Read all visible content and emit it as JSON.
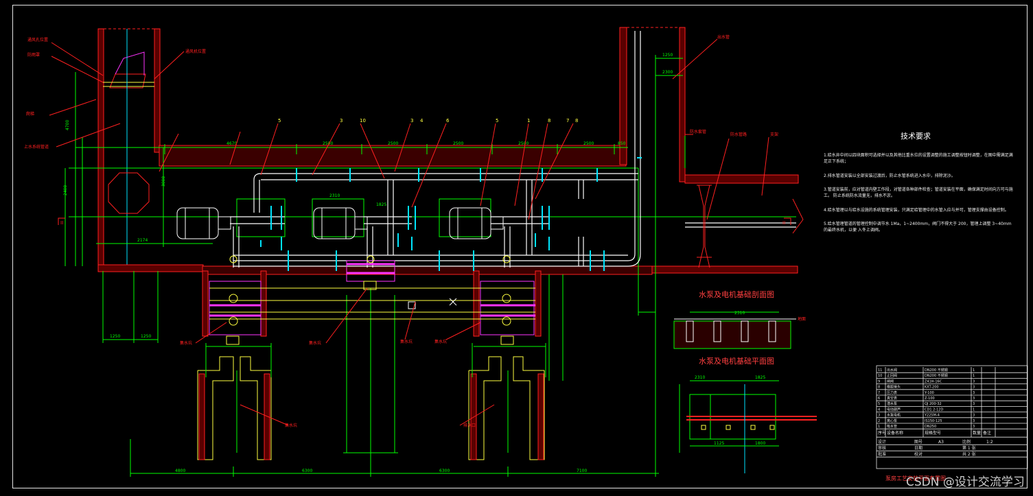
{
  "sheet": {
    "technical_requirements_title": "技术要求",
    "notes": [
      "1.给水井中间以四块面积可选择并以及其他比重水位的设置调整的施工调整按钮时调整，在图中需满足满足正下系统；",
      "2.排水管道安装以全部安装过渡后，防止水管系统进入水中，排除泥沙。",
      "3.管道安装前，应对管道内壁工作段，对管道各种部件检查；管道安装在平面，确保满足时间向方可与施工。 防止系统防水流量无，排水不淤。",
      "4.给水管理以与给水设施的系统管理安装，只满足给管理中的水管入应与并可，管理支撑由设备控制。",
      "5.给水管理管道的管理控制中调节水 1Ma，1~2400mm，阀门不得大于 200，管理上调整 3~40mm 的最终水机，以便 入冬上调阀。"
    ],
    "section_view_title": "水泵及电机基础剖面图",
    "plan_view_title": "水泵及电机基础平面图",
    "watermark": "CSDN @设计交流学习",
    "drawing_caption": "泵房工艺安装平面布置图"
  },
  "colors": {
    "background": "#000000",
    "wall": "#ff2020",
    "pipe": "#ffffff",
    "dimension": "#00ff00",
    "valve": "#00e5ff",
    "leader": "#ff2020",
    "accent": "#ff33ff",
    "yellow": "#ffff40"
  },
  "dimensions": {
    "top_row": [
      "4670",
      "2500",
      "2500",
      "2500",
      "2500",
      "2500",
      "850"
    ],
    "bottom_row": [
      "4800",
      "6300",
      "6300",
      "7100"
    ],
    "right_top": [
      "1250",
      "2300"
    ],
    "left_labels": [
      "4700",
      "3000",
      "2400",
      "1250",
      "1250",
      "2174"
    ],
    "pump_widths": [
      "2310",
      "1825"
    ],
    "detail_top": [
      "2310",
      "1825"
    ],
    "detail_mid": [
      "1125",
      "1800"
    ],
    "detail_right": [
      "1275"
    ],
    "detail_left": [
      "1800"
    ]
  },
  "callouts": {
    "numbers_top": [
      "5",
      "3",
      "10",
      "3",
      "4",
      "6",
      "5",
      "1",
      "8",
      "7",
      "8"
    ],
    "left_leaders": [
      "通风孔位置",
      "防雨罩",
      "通风机位置",
      "爬梯",
      "上水系统管道"
    ],
    "right_leaders": [
      "出水管",
      "防水套管",
      "防水管路",
      "支架",
      "地面"
    ],
    "bottom_leaders": [
      "集水坑",
      "集水坑",
      "集水坑",
      "集水坑",
      "集水坑",
      "排水口"
    ]
  },
  "title_block": {
    "rows": [
      [
        "11",
        "出水阀",
        "DN200 不锈钢",
        "1",
        ""
      ],
      [
        "10",
        "止回阀",
        "DN200 不锈钢",
        "1",
        ""
      ],
      [
        "9",
        "闸阀",
        "Z41H-16C",
        "3",
        ""
      ],
      [
        "8",
        "橡胶接头",
        "KXT-200",
        "3",
        ""
      ],
      [
        "7",
        "压力表",
        "Y-100",
        "3",
        ""
      ],
      [
        "6",
        "真空表",
        "Z-100",
        "3",
        ""
      ],
      [
        "5",
        "潜水泵",
        "QJ 200-32",
        "3",
        ""
      ],
      [
        "4",
        "电动葫芦",
        "CD1 2-12D",
        "1",
        ""
      ],
      [
        "3",
        "水泵电机",
        "Y225M-4",
        "3",
        ""
      ],
      [
        "2",
        "离心泵",
        "IS150-125",
        "3",
        ""
      ],
      [
        "1",
        "吸水管",
        "DN250",
        "3",
        ""
      ]
    ],
    "header": [
      "序号",
      "设备名称",
      "规格型号",
      "数量",
      "备注"
    ],
    "bottom": [
      [
        "设计",
        "",
        "图号",
        "A3",
        "比例",
        "1:2"
      ],
      [
        "审核",
        "",
        "日期",
        "",
        "第 1 张",
        ""
      ],
      [
        "批准",
        "",
        "校对",
        "",
        "共 2 张",
        ""
      ]
    ]
  },
  "markers": {
    "section_left": "II",
    "section_right": "II"
  }
}
